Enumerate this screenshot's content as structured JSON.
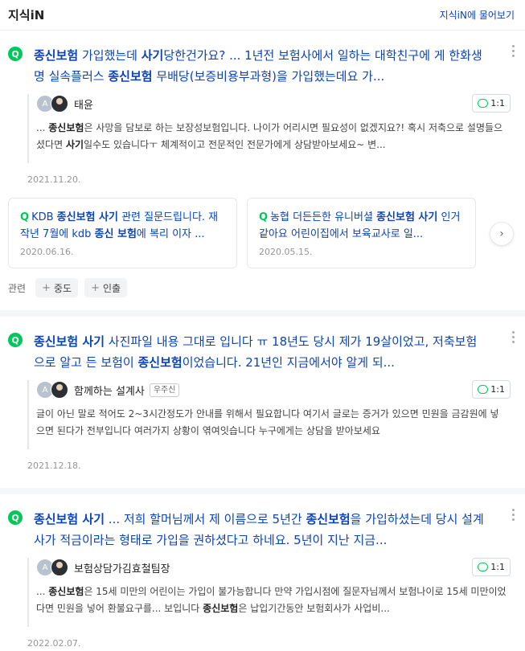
{
  "header": {
    "title": "지식iN",
    "ask_link": "지식iN에 물어보기"
  },
  "items": [
    {
      "title_segments": [
        {
          "t": "종신보험",
          "b": true
        },
        {
          "t": " 가입했는데 ",
          "b": false
        },
        {
          "t": "사기",
          "b": true
        },
        {
          "t": "당한건가요? ... 1년전 보험사에서 일하는 대학친구",
          "b": false
        },
        {
          "t": "에",
          "b": false
        },
        {
          "t": " 게 한화생명 실속플러스 ",
          "b": false
        },
        {
          "t": "종신보험",
          "b": true
        },
        {
          "t": " 무배당(보증비용부과형)을 가입했는데요 가...",
          "b": false
        }
      ],
      "answer": {
        "avatar_letter": "A",
        "name": "태윤",
        "badge": "",
        "count": "1:1",
        "text_segments": [
          {
            "t": "... ",
            "b": false
          },
          {
            "t": "종신보험",
            "b": true
          },
          {
            "t": "은 사망을 담보로 하는 보장성보험입니다. 나이가 어리시면 필요성이 없겠지요?! 혹시 저축으로 설명들으셨다면 ",
            "b": false
          },
          {
            "t": "사기",
            "b": true
          },
          {
            "t": "일수도 있습니다ㅜ 체계적이고 전문적인 전문가에게 상담받아보세요~ 변...",
            "b": false
          }
        ]
      },
      "date": "2021.11.20.",
      "cards": [
        {
          "segments": [
            {
              "t": "KDB ",
              "b": false
            },
            {
              "t": "종신보험 사기",
              "b": true
            },
            {
              "t": " 관련 질문드립니다. 재작년 7월에 kdb ",
              "b": false
            },
            {
              "t": "종신 보험",
              "b": true
            },
            {
              "t": "에 복리 이자 ...",
              "b": false
            }
          ],
          "date": "2020.06.16."
        },
        {
          "segments": [
            {
              "t": "농협 더든든한 유니버셜 ",
              "b": false
            },
            {
              "t": "종신보험 사기",
              "b": true
            },
            {
              "t": " 인거 같아요 어린이집에서 보육교사로 일...",
              "b": false
            }
          ],
          "date": "2020.05.15."
        }
      ],
      "related_label": "관련",
      "related": [
        "중도",
        "인출"
      ]
    },
    {
      "title_segments": [
        {
          "t": "종신보험 사기",
          "b": true
        },
        {
          "t": " 사진파일 내용 그대로 입니다 ㅠ 18년도 당시 제가 19살이었고, 저축보험으로 알고 든 보험이 ",
          "b": false
        },
        {
          "t": "종신보험",
          "b": true
        },
        {
          "t": "이었습니다. 21년인 지금에서야 알게 되...",
          "b": false
        }
      ],
      "answer": {
        "avatar_letter": "A",
        "name": "함께하는 설계사",
        "badge": "우주신",
        "count": "1:1",
        "text_segments": [
          {
            "t": "글이 아닌 말로 적어도 2~3시간정도가 안내를 위해서 필요합니다 여기서 글로는 증거가 있으면 민원을 금감원에 넣으면 된다가 전부입니다 여러가지 상황이 엮여잇습니다 누구에게는 상담을 받아보세요",
            "b": false
          }
        ]
      },
      "date": "2021.12.18."
    },
    {
      "title_segments": [
        {
          "t": "종신보험 사기",
          "b": true
        },
        {
          "t": " ... 저희 할머님께서 제 이름으로 5년간 ",
          "b": false
        },
        {
          "t": "종신보험",
          "b": true
        },
        {
          "t": "을 가입하셨는데 당시 설계사가 적금이라는 형태로 가입을 권하셨다고 하네요. 5년이 지난 지금...",
          "b": false
        }
      ],
      "answer": {
        "avatar_letter": "A",
        "name": "보험상담가김효철팀장",
        "badge": "",
        "count": "1:1",
        "text_segments": [
          {
            "t": "... ",
            "b": false
          },
          {
            "t": "종신보험",
            "b": true
          },
          {
            "t": "은 15세 미만의 어린이는 가입이 불가능합니다 만약 가입시점에 질문자님께서 보험나이로 15세 미만이었다면 민원을 넣어 환불요구를... 보입니다 ",
            "b": false
          },
          {
            "t": "종신보험",
            "b": true
          },
          {
            "t": "은 납입기간동안 보험회사가 사업비...",
            "b": false
          }
        ]
      },
      "date": "2022.02.07."
    }
  ]
}
